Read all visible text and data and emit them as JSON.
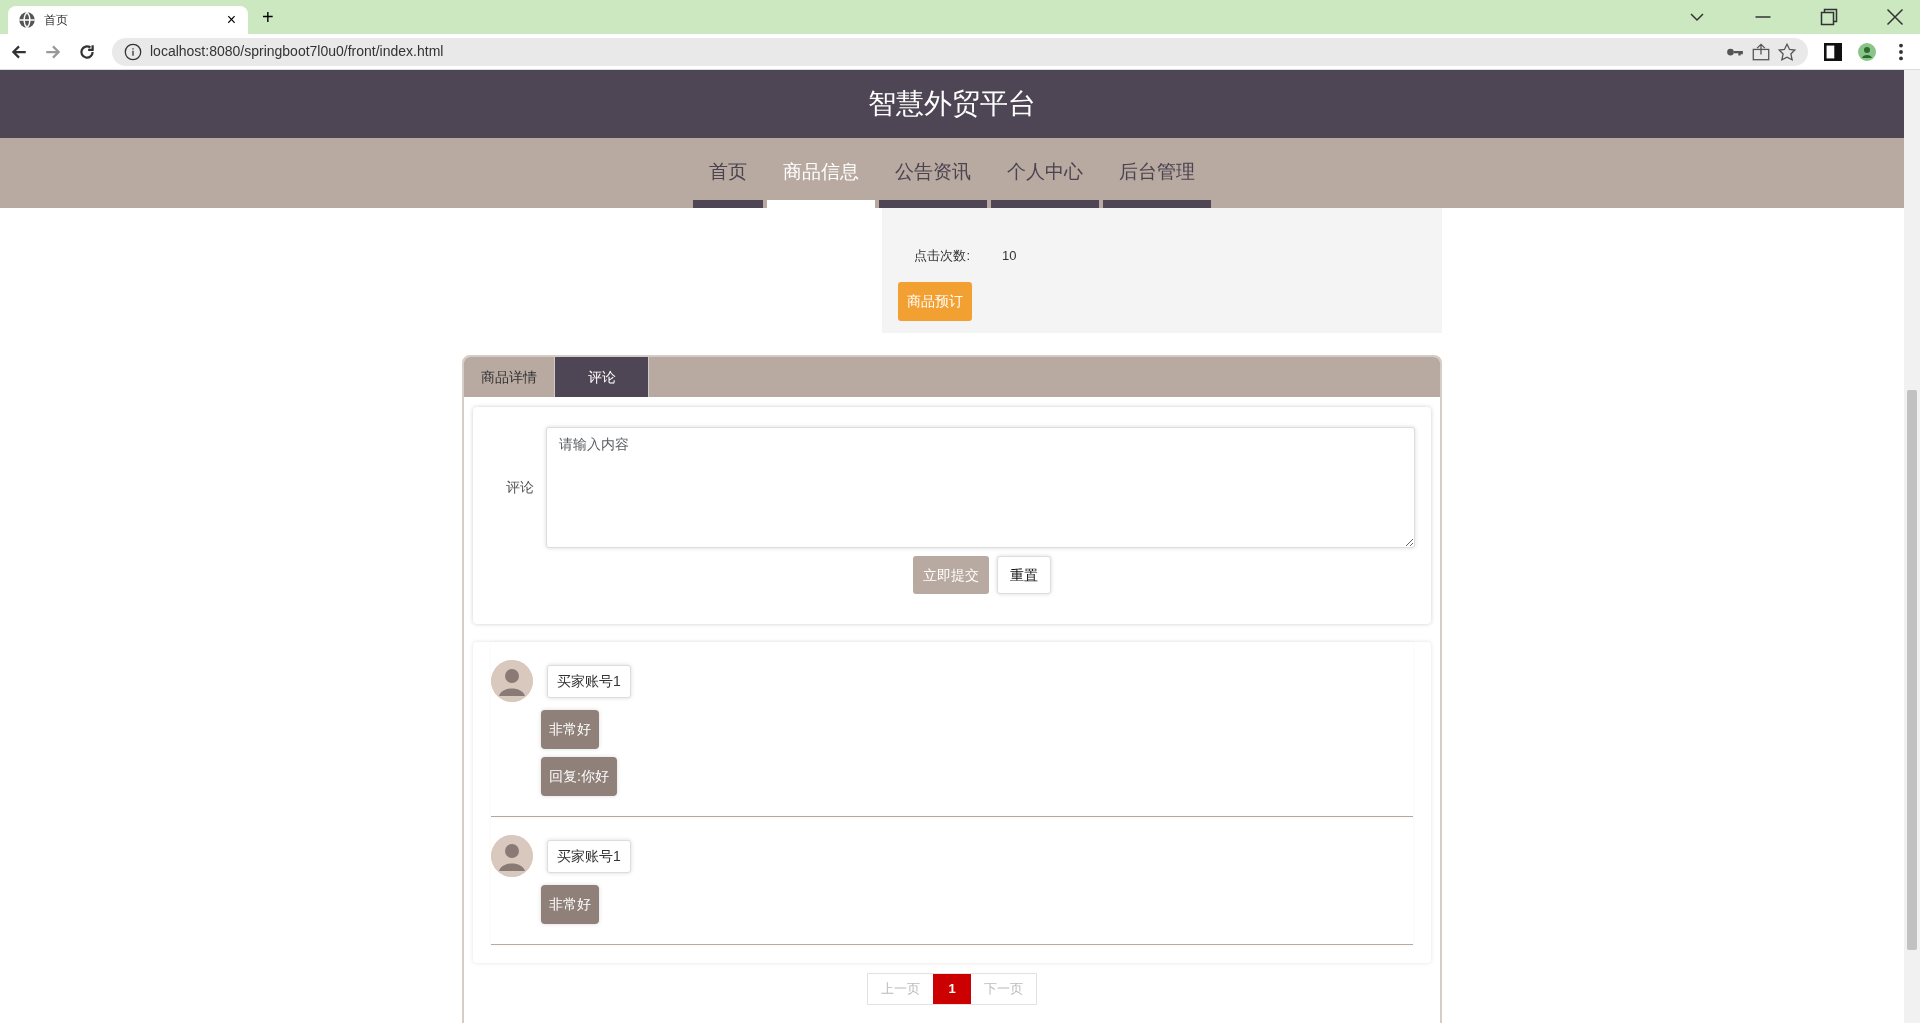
{
  "browser": {
    "tab_title": "首页",
    "tab_close": "×",
    "new_tab": "+",
    "url": "localhost:8080/springboot7l0u0/front/index.html"
  },
  "site_title": "智慧外贸平台",
  "nav": [
    {
      "label": "首页",
      "selected": false
    },
    {
      "label": "商品信息",
      "selected": true
    },
    {
      "label": "公告资讯",
      "selected": false
    },
    {
      "label": "个人中心",
      "selected": false
    },
    {
      "label": "后台管理",
      "selected": false
    }
  ],
  "product": {
    "click_label": "点击次数:",
    "click_count": "10",
    "order_button": "商品预订"
  },
  "detail_tabs": [
    {
      "label": "商品详情",
      "selected": false
    },
    {
      "label": "评论",
      "selected": true
    }
  ],
  "comment_form": {
    "label": "评论",
    "placeholder": "请输入内容",
    "submit": "立即提交",
    "reset": "重置"
  },
  "comments": [
    {
      "user": "买家账号1",
      "content": "非常好",
      "reply": "回复:你好"
    },
    {
      "user": "买家账号1",
      "content": "非常好"
    }
  ],
  "pagination": {
    "prev": "上一页",
    "pages": [
      {
        "label": "1",
        "selected": true
      }
    ],
    "next": "下一页"
  }
}
